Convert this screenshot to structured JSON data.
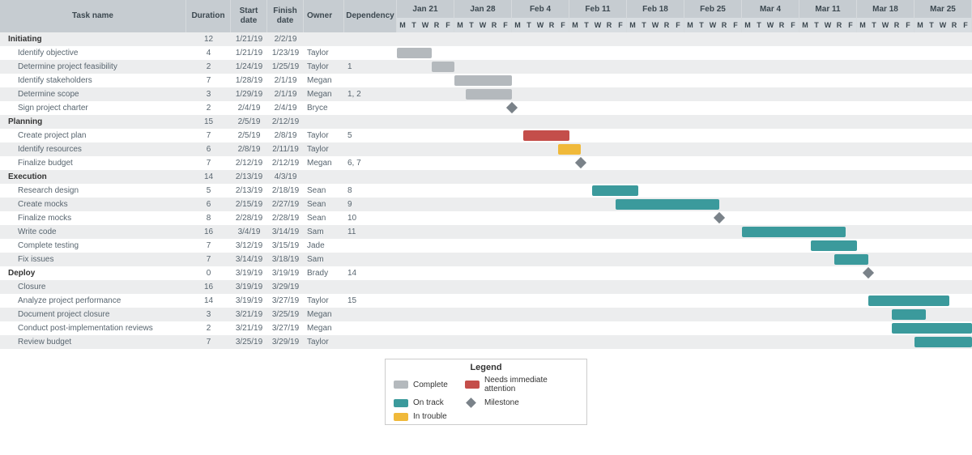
{
  "chart_data": {
    "type": "gantt",
    "title": "",
    "timeline_start": "1/21/19",
    "timeline_end": "3/29/19",
    "weeks": [
      "Jan 21",
      "Jan 28",
      "Feb 4",
      "Feb 11",
      "Feb 18",
      "Feb 25",
      "Mar 4",
      "Mar 11",
      "Mar 18",
      "Mar 25"
    ],
    "days": [
      "M",
      "T",
      "W",
      "R",
      "F"
    ],
    "legend": {
      "title": "Legend",
      "items": [
        {
          "key": "complete",
          "label": "Complete",
          "color": "#b4b9bd"
        },
        {
          "key": "ontrack",
          "label": "On track",
          "color": "#3b9a9c"
        },
        {
          "key": "trouble",
          "label": "In trouble",
          "color": "#f0b93a"
        },
        {
          "key": "attention",
          "label": "Needs immediate attention",
          "color": "#c44e4a"
        },
        {
          "key": "milestone",
          "label": "Milestone",
          "color": "#7a8289"
        }
      ]
    }
  },
  "columns": {
    "task": "Task name",
    "duration": "Duration",
    "start": "Start date",
    "finish": "Finish date",
    "owner": "Owner",
    "dependency": "Dependency"
  },
  "rows": [
    {
      "type": "phase",
      "task": "Initiating",
      "duration": "12",
      "start": "1/21/19",
      "finish": "2/2/19",
      "owner": "",
      "dep": ""
    },
    {
      "type": "task",
      "task": "Identify objective",
      "duration": "4",
      "start": "1/21/19",
      "finish": "1/23/19",
      "owner": "Taylor",
      "dep": "",
      "bar": {
        "day_start": 0,
        "day_span": 3,
        "status": "complete"
      }
    },
    {
      "type": "task",
      "task": "Determine project feasibility",
      "duration": "2",
      "start": "1/24/19",
      "finish": "1/25/19",
      "owner": "Taylor",
      "dep": "1",
      "bar": {
        "day_start": 3,
        "day_span": 2,
        "status": "complete"
      },
      "arrow_from_prev": true
    },
    {
      "type": "task",
      "task": "Identify stakeholders",
      "duration": "7",
      "start": "1/28/19",
      "finish": "2/1/19",
      "owner": "Megan",
      "dep": "",
      "bar": {
        "day_start": 5,
        "day_span": 5,
        "status": "complete"
      }
    },
    {
      "type": "task",
      "task": "Determine scope",
      "duration": "3",
      "start": "1/29/19",
      "finish": "2/1/19",
      "owner": "Megan",
      "dep": "1, 2",
      "bar": {
        "day_start": 6,
        "day_span": 4,
        "status": "complete"
      },
      "arrow_from_prev": true
    },
    {
      "type": "task",
      "task": "Sign project charter",
      "duration": "2",
      "start": "2/4/19",
      "finish": "2/4/19",
      "owner": "Bryce",
      "dep": "",
      "milestone": {
        "day": 10
      }
    },
    {
      "type": "phase",
      "task": "Planning",
      "duration": "15",
      "start": "2/5/19",
      "finish": "2/12/19",
      "owner": "",
      "dep": ""
    },
    {
      "type": "task",
      "task": "Create project plan",
      "duration": "7",
      "start": "2/5/19",
      "finish": "2/8/19",
      "owner": "Taylor",
      "dep": "5",
      "bar": {
        "day_start": 11,
        "day_span": 4,
        "status": "attention"
      },
      "arrow_from_prev": true
    },
    {
      "type": "task",
      "task": "Identify resources",
      "duration": "6",
      "start": "2/8/19",
      "finish": "2/11/19",
      "owner": "Taylor",
      "dep": "",
      "bar": {
        "day_start": 14,
        "day_span": 2,
        "status": "trouble"
      }
    },
    {
      "type": "task",
      "task": "Finalize budget",
      "duration": "7",
      "start": "2/12/19",
      "finish": "2/12/19",
      "owner": "Megan",
      "dep": "6, 7",
      "milestone": {
        "day": 16
      },
      "arrow_from_prev": true
    },
    {
      "type": "phase",
      "task": "Execution",
      "duration": "14",
      "start": "2/13/19",
      "finish": "4/3/19",
      "owner": "",
      "dep": ""
    },
    {
      "type": "task",
      "task": "Research design",
      "duration": "5",
      "start": "2/13/19",
      "finish": "2/18/19",
      "owner": "Sean",
      "dep": "8",
      "bar": {
        "day_start": 17,
        "day_span": 4,
        "status": "ontrack"
      }
    },
    {
      "type": "task",
      "task": "Create mocks",
      "duration": "6",
      "start": "2/15/19",
      "finish": "2/27/19",
      "owner": "Sean",
      "dep": "9",
      "bar": {
        "day_start": 19,
        "day_span": 9,
        "status": "ontrack"
      },
      "arrow_from_prev": true
    },
    {
      "type": "task",
      "task": "Finalize mocks",
      "duration": "8",
      "start": "2/28/19",
      "finish": "2/28/19",
      "owner": "Sean",
      "dep": "10",
      "milestone": {
        "day": 28
      },
      "arrow_from_prev": true
    },
    {
      "type": "task",
      "task": "Write code",
      "duration": "16",
      "start": "3/4/19",
      "finish": "3/14/19",
      "owner": "Sam",
      "dep": "11",
      "bar": {
        "day_start": 30,
        "day_span": 9,
        "status": "ontrack"
      },
      "arrow_from_prev": true
    },
    {
      "type": "task",
      "task": "Complete testing",
      "duration": "7",
      "start": "3/12/19",
      "finish": "3/15/19",
      "owner": "Jade",
      "dep": "",
      "bar": {
        "day_start": 36,
        "day_span": 4,
        "status": "ontrack"
      }
    },
    {
      "type": "task",
      "task": "Fix issues",
      "duration": "7",
      "start": "3/14/19",
      "finish": "3/18/19",
      "owner": "Sam",
      "dep": "",
      "bar": {
        "day_start": 38,
        "day_span": 3,
        "status": "ontrack"
      }
    },
    {
      "type": "phase",
      "task": "Deploy",
      "duration": "0",
      "start": "3/19/19",
      "finish": "3/19/19",
      "owner": "Brady",
      "dep": "14",
      "milestone": {
        "day": 41
      },
      "arrow_from_prev": true
    },
    {
      "type": "task",
      "task": "Closure",
      "duration": "16",
      "start": "3/19/19",
      "finish": "3/29/19",
      "owner": "",
      "dep": ""
    },
    {
      "type": "task",
      "task": "Analyze project performance",
      "duration": "14",
      "start": "3/19/19",
      "finish": "3/27/19",
      "owner": "Taylor",
      "dep": "15",
      "bar": {
        "day_start": 41,
        "day_span": 7,
        "status": "ontrack"
      }
    },
    {
      "type": "task",
      "task": "Document project closure",
      "duration": "3",
      "start": "3/21/19",
      "finish": "3/25/19",
      "owner": "Megan",
      "dep": "",
      "bar": {
        "day_start": 43,
        "day_span": 3,
        "status": "ontrack"
      }
    },
    {
      "type": "task",
      "task": "Conduct post-implementation reviews",
      "duration": "2",
      "start": "3/21/19",
      "finish": "3/27/19",
      "owner": "Megan",
      "dep": "",
      "bar": {
        "day_start": 43,
        "day_span": 7,
        "status": "ontrack"
      }
    },
    {
      "type": "task",
      "task": "Review budget",
      "duration": "7",
      "start": "3/25/19",
      "finish": "3/29/19",
      "owner": "Taylor",
      "dep": "",
      "bar": {
        "day_start": 45,
        "day_span": 5,
        "status": "ontrack"
      }
    }
  ]
}
